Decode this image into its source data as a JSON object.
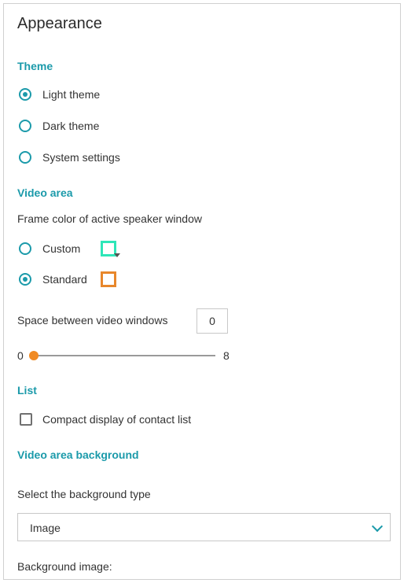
{
  "title": "Appearance",
  "theme": {
    "heading": "Theme",
    "options": [
      {
        "label": "Light theme",
        "checked": true
      },
      {
        "label": "Dark theme",
        "checked": false
      },
      {
        "label": "System settings",
        "checked": false
      }
    ]
  },
  "video_area": {
    "heading": "Video area",
    "frame_color_label": "Frame color of active speaker window",
    "options": [
      {
        "label": "Custom",
        "checked": false,
        "color": "#2ee6b8"
      },
      {
        "label": "Standard",
        "checked": true,
        "color": "#e8872b"
      }
    ],
    "spacing_label": "Space between video windows",
    "spacing_value": "0",
    "slider": {
      "min": "0",
      "max": "8",
      "value": 0
    }
  },
  "list": {
    "heading": "List",
    "compact_label": "Compact display of contact list",
    "compact_checked": false
  },
  "background": {
    "heading": "Video area background",
    "select_label": "Select the background type",
    "selected": "Image",
    "image_label": "Background image:"
  },
  "colors": {
    "accent": "#1b9aaa",
    "slider_thumb": "#f08a24"
  }
}
